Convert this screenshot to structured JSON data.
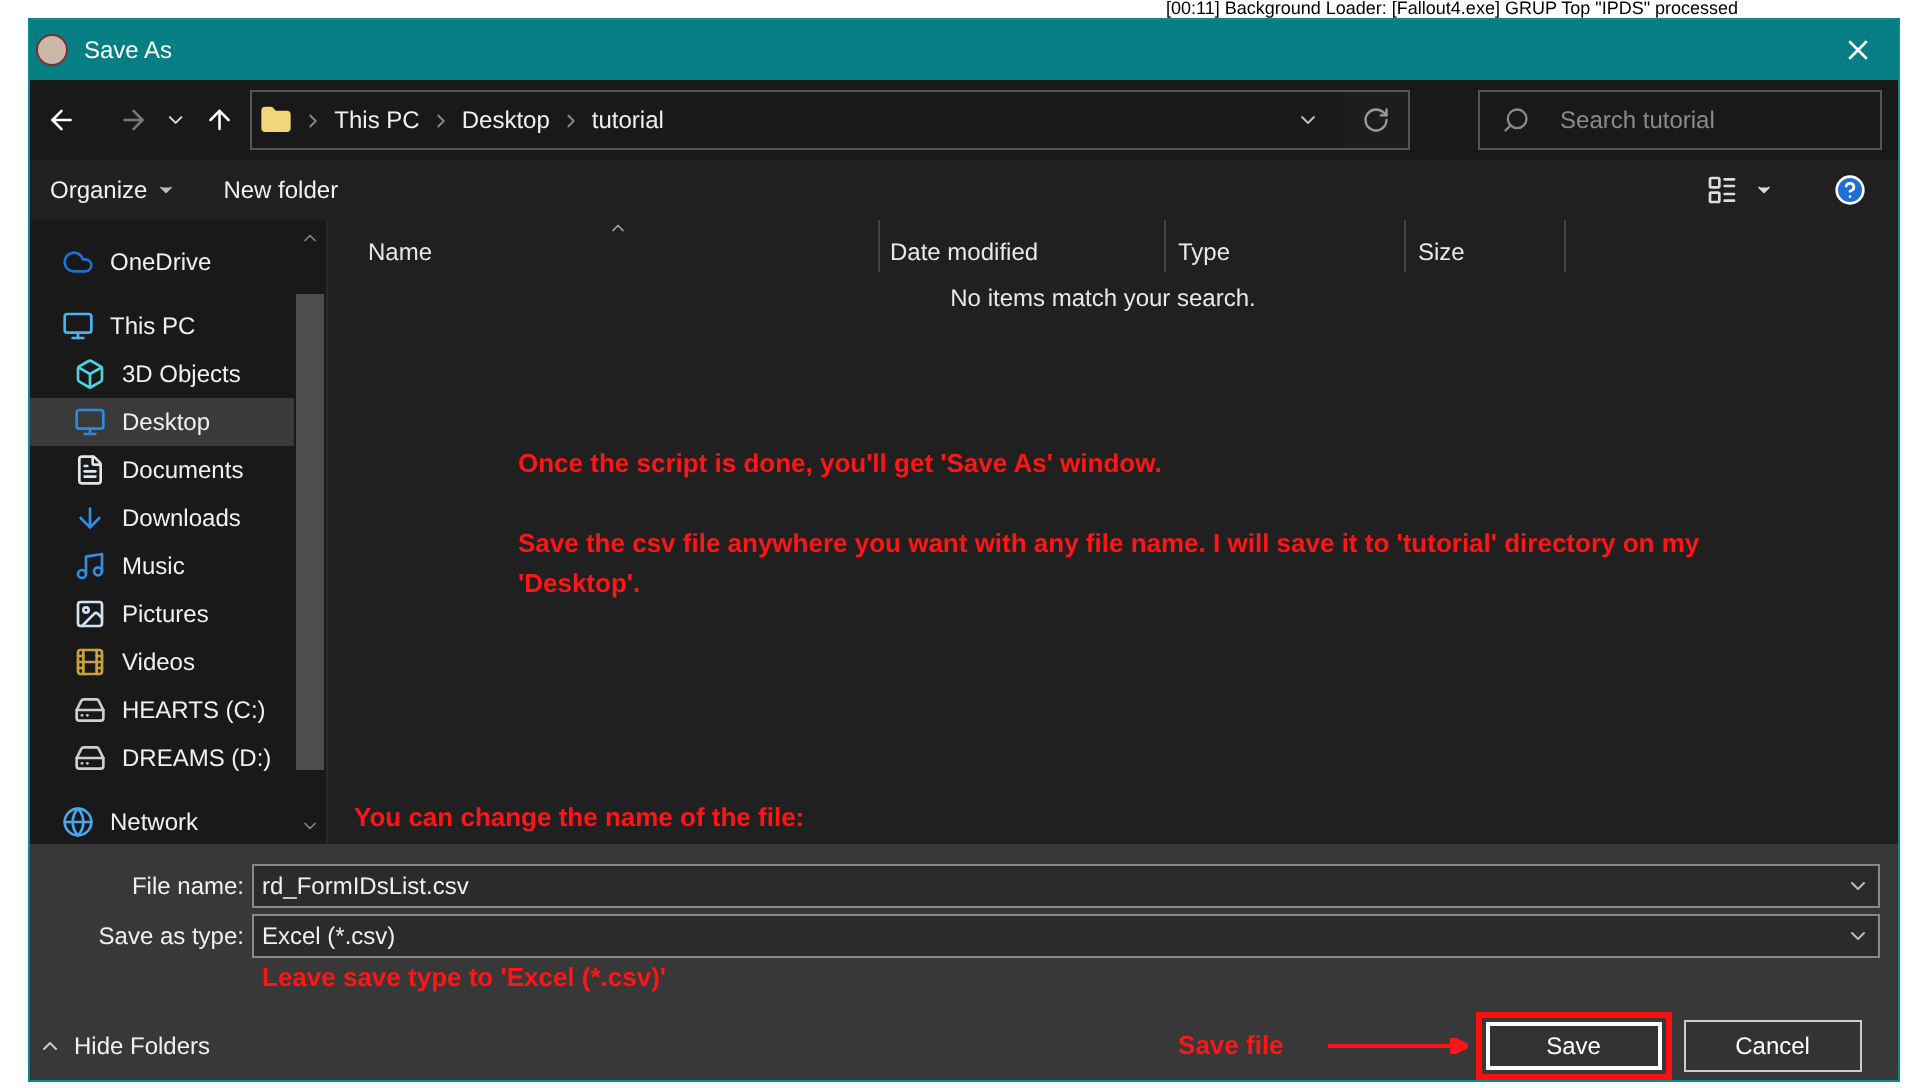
{
  "background_log": "[00:11] Background Loader: [Fallout4.exe] GRUP Top \"IPDS\" processed",
  "window": {
    "title": "Save As"
  },
  "address": {
    "path": [
      "This PC",
      "Desktop",
      "tutorial"
    ]
  },
  "search": {
    "placeholder": "Search tutorial"
  },
  "commands": [
    {
      "label": "Organize",
      "kind": "menu"
    },
    {
      "label": "New folder",
      "kind": "plain"
    }
  ],
  "nav": [
    {
      "label": "OneDrive",
      "kind": "cloud",
      "selected": false
    },
    {
      "label": "This PC",
      "kind": "computer",
      "selected": false,
      "children": [
        {
          "label": "3D Objects",
          "kind": "cube",
          "selected": false
        },
        {
          "label": "Desktop",
          "kind": "desktop",
          "selected": true
        },
        {
          "label": "Documents",
          "kind": "document",
          "selected": false
        },
        {
          "label": "Downloads",
          "kind": "download",
          "selected": false
        },
        {
          "label": "Music",
          "kind": "music",
          "selected": false
        },
        {
          "label": "Pictures",
          "kind": "pictures",
          "selected": false
        },
        {
          "label": "Videos",
          "kind": "videos",
          "selected": false
        },
        {
          "label": "HEARTS (C:)",
          "kind": "drive",
          "selected": false
        },
        {
          "label": "DREAMS (D:)",
          "kind": "drive",
          "selected": false
        }
      ]
    },
    {
      "label": "Network",
      "kind": "network",
      "selected": false
    }
  ],
  "columns": [
    "Name",
    "Date modified",
    "Type",
    "Size"
  ],
  "empty_message": "No items match your search.",
  "fields": [
    {
      "label": "File name:",
      "value": "rd_FormIDsList.csv"
    },
    {
      "label": "Save as type:",
      "value": "Excel (*.csv)"
    }
  ],
  "hide_folders": "Hide Folders",
  "buttons": [
    {
      "label": "Save",
      "kind": "primary"
    },
    {
      "label": "Cancel",
      "kind": "secondary"
    }
  ],
  "annotations": {
    "intro": "Once the script is done, you'll get 'Save As' window.",
    "save_location": "Save the csv file anywhere you want with any file name. I will save it to 'tutorial' directory on my 'Desktop'.",
    "rename": "You can change the name of the file:",
    "type_hint": "Leave save type to 'Excel (*.csv)'",
    "save_hint": "Save file"
  }
}
